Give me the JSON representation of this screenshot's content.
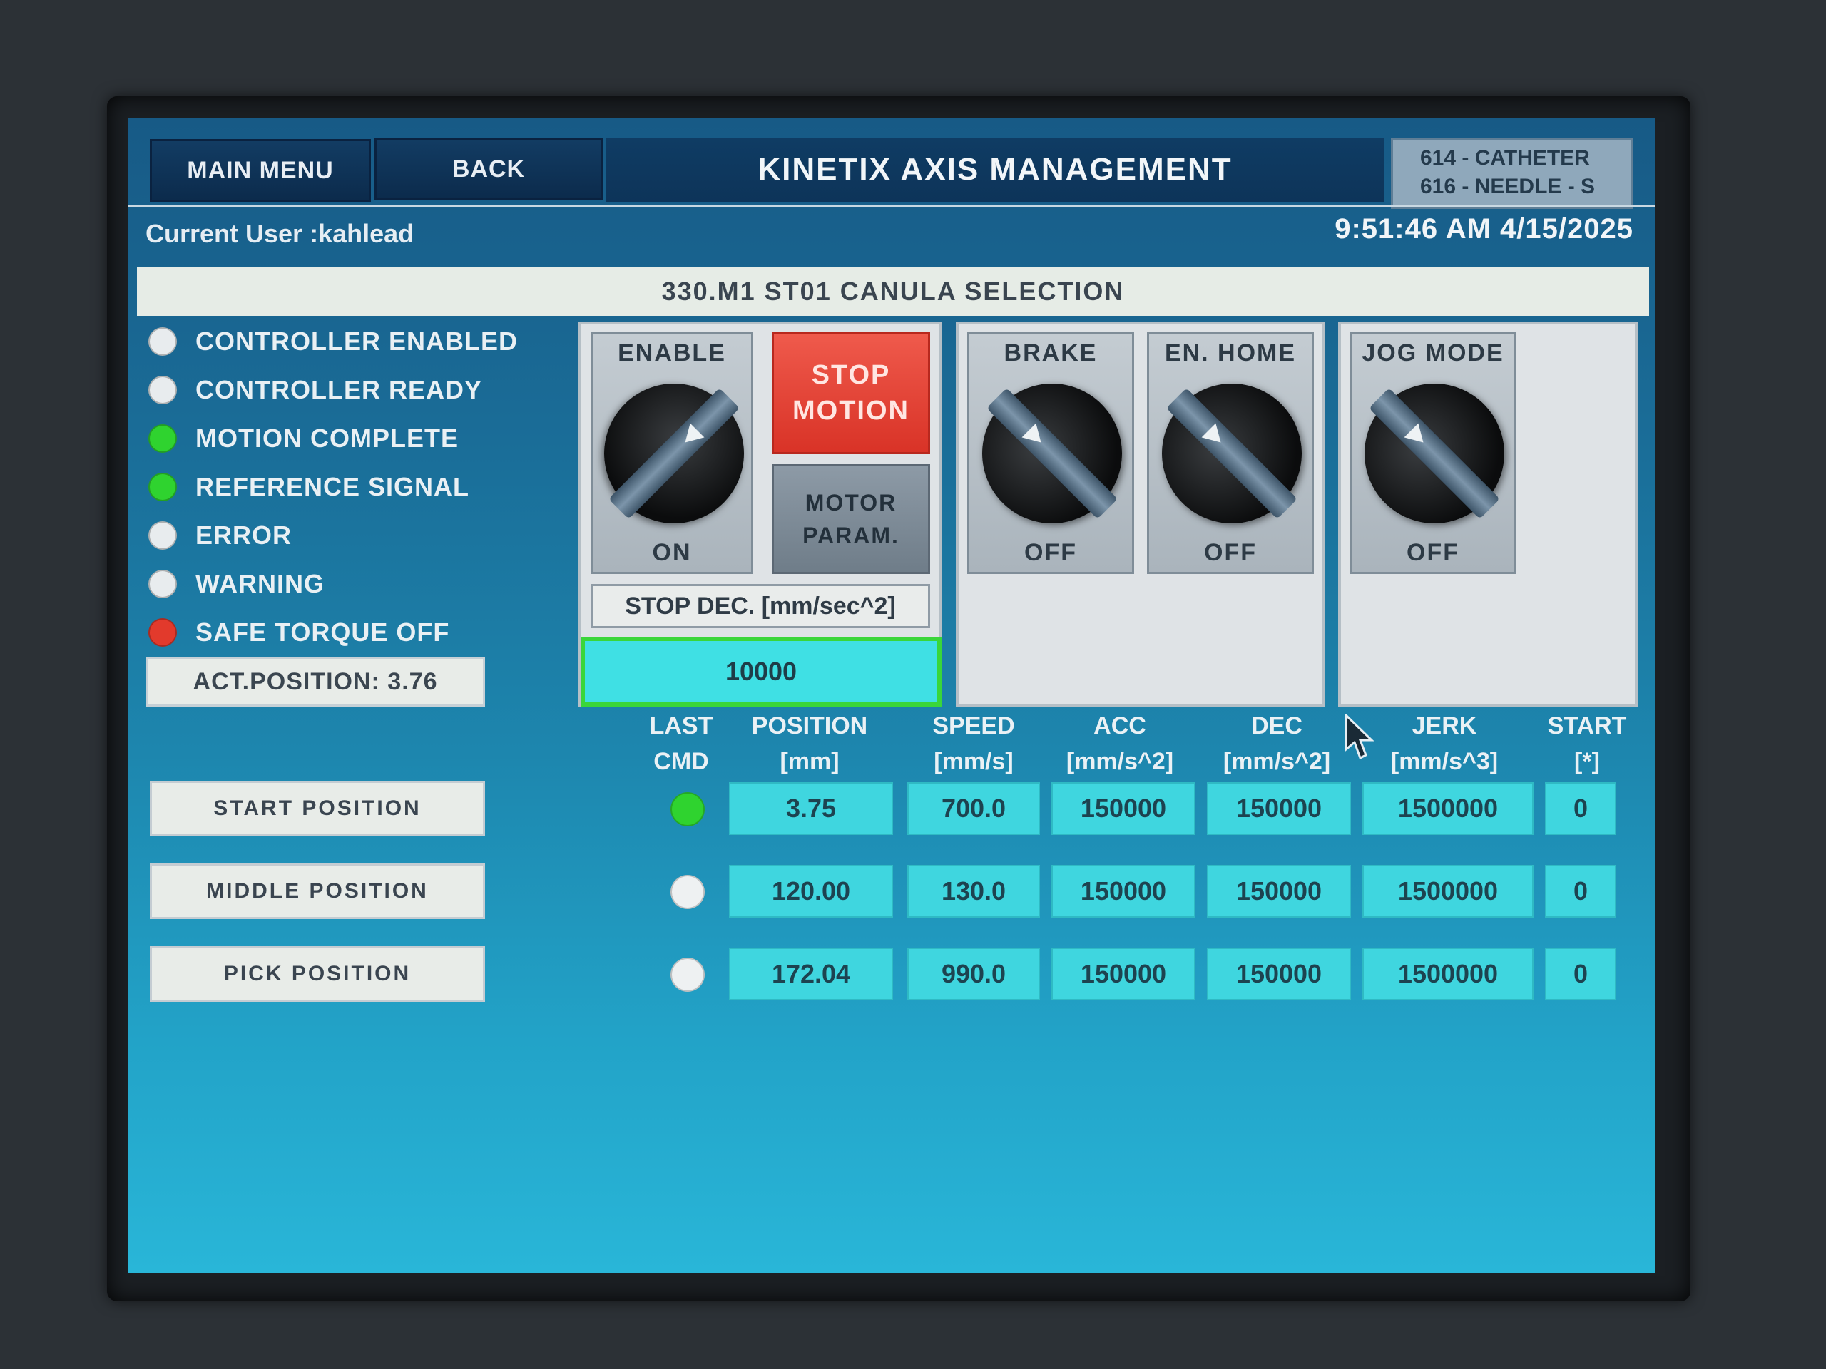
{
  "header": {
    "main_menu": "MAIN MENU",
    "back": "BACK",
    "title": "KINETIX AXIS MANAGEMENT",
    "product_line1": "614 - CATHETER",
    "product_line2": "616 - NEEDLE - S"
  },
  "user": {
    "label": "Current User :kahlead"
  },
  "clock": {
    "datetime": "9:51:46 AM 4/15/2025"
  },
  "banner": {
    "title": "330.M1 ST01 CANULA SELECTION"
  },
  "status": [
    {
      "label": "CONTROLLER ENABLED",
      "color": "#e8ecee"
    },
    {
      "label": "CONTROLLER READY",
      "color": "#e8ecee"
    },
    {
      "label": "MOTION COMPLETE",
      "color": "#2fd32f"
    },
    {
      "label": "REFERENCE SIGNAL",
      "color": "#2fd32f"
    },
    {
      "label": "ERROR",
      "color": "#e8ecee"
    },
    {
      "label": "WARNING",
      "color": "#e8ecee"
    },
    {
      "label": "SAFE TORQUE OFF",
      "color": "#e23a2c"
    }
  ],
  "act_position": "ACT.POSITION: 3.76",
  "switches": {
    "enable": {
      "label": "ENABLE",
      "state": "ON"
    },
    "brake": {
      "label": "BRAKE",
      "state": "OFF"
    },
    "en_home": {
      "label": "EN. HOME",
      "state": "OFF"
    },
    "jog_mode": {
      "label": "JOG MODE",
      "state": "OFF"
    }
  },
  "stop_motion": {
    "line1": "STOP",
    "line2": "MOTION"
  },
  "motor_param": {
    "line1": "MOTOR",
    "line2": "PARAM."
  },
  "stop_dec": {
    "label": "STOP DEC. [mm/sec^2]",
    "value": "10000"
  },
  "table": {
    "headers": [
      {
        "line1": "LAST",
        "line2": "CMD"
      },
      {
        "line1": "POSITION",
        "line2": "[mm]"
      },
      {
        "line1": "SPEED",
        "line2": "[mm/s]"
      },
      {
        "line1": "ACC",
        "line2": "[mm/s^2]"
      },
      {
        "line1": "DEC",
        "line2": "[mm/s^2]"
      },
      {
        "line1": "JERK",
        "line2": "[mm/s^3]"
      },
      {
        "line1": "START",
        "line2": "[*]"
      }
    ],
    "rows": [
      {
        "button": "START POSITION",
        "cmd_color": "#2fd32f",
        "position": "3.75",
        "speed": "700.0",
        "acc": "150000",
        "dec": "150000",
        "jerk": "1500000",
        "start": "0"
      },
      {
        "button": "MIDDLE POSITION",
        "cmd_color": "#eef1f2",
        "position": "120.00",
        "speed": "130.0",
        "acc": "150000",
        "dec": "150000",
        "jerk": "1500000",
        "start": "0"
      },
      {
        "button": "PICK POSITION",
        "cmd_color": "#eef1f2",
        "position": "172.04",
        "speed": "990.0",
        "acc": "150000",
        "dec": "150000",
        "jerk": "1500000",
        "start": "0"
      }
    ]
  }
}
